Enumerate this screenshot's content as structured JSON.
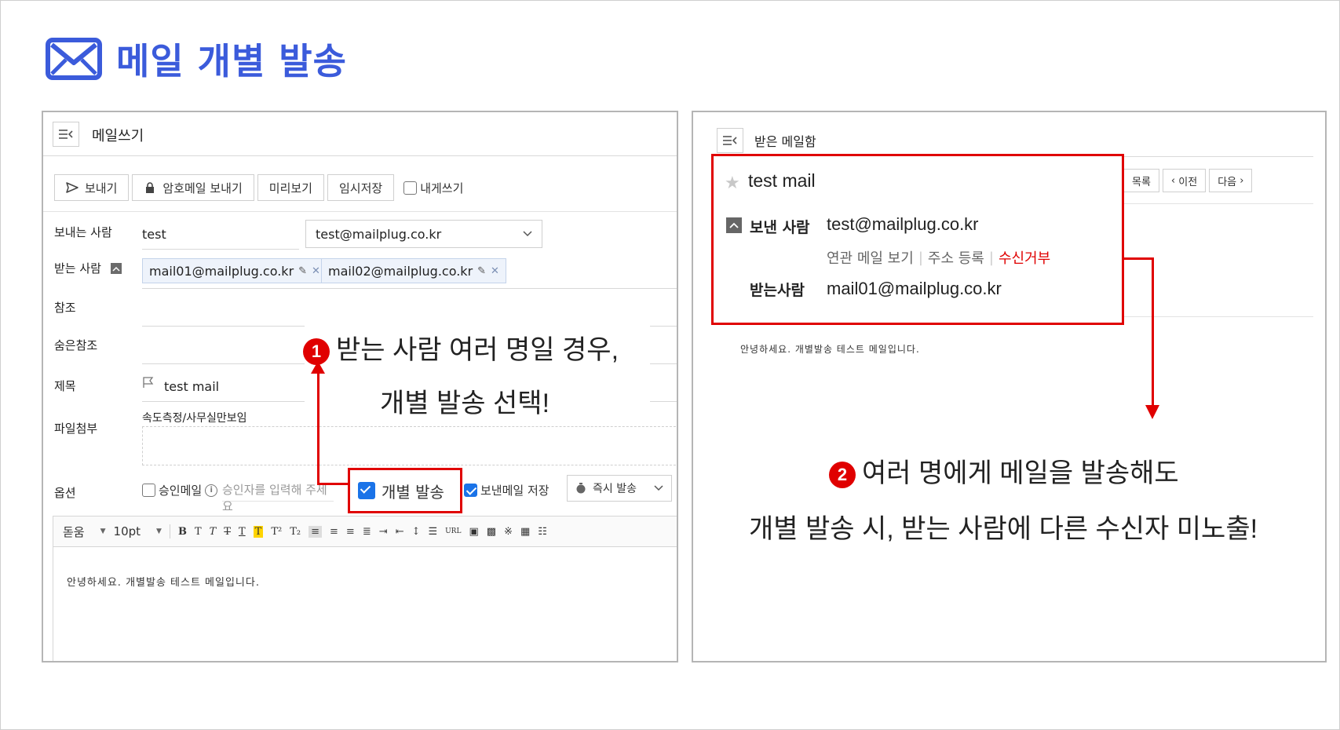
{
  "page": {
    "title": "메일 개별 발송",
    "accent_color": "#3b5bdb",
    "annotation_color": "#e00000"
  },
  "compose": {
    "header_title": "메일쓰기",
    "toolbar": {
      "send_label": "보내기",
      "secure_send_label": "암호메일 보내기",
      "preview_label": "미리보기",
      "draft_label": "임시저장",
      "self_label": "내게쓰기"
    },
    "from_label": "보내는 사람",
    "from_name": "test",
    "from_email": "test@mailplug.co.kr",
    "to_label": "받는 사람",
    "recipients": [
      "mail01@mailplug.co.kr",
      "mail02@mailplug.co.kr"
    ],
    "cc_label": "참조",
    "bcc_label": "숨은참조",
    "subject_label": "제목",
    "subject_value": "test mail",
    "attach_label": "파일첨부",
    "attach_file": "속도측정/사무실만보임",
    "options_label": "옵션",
    "approval_label": "승인메일",
    "approver_placeholder": "승인자를 입력해 주세요",
    "individual_send_label": "개별 발송",
    "save_sent_label": "보낸메일 저장",
    "send_timing": "즉시 발송",
    "editor_font": "돋움",
    "editor_size": "10pt",
    "body_text": "안녕하세요. 개별발송 테스트 메일입니다."
  },
  "callout1": {
    "number": "1",
    "line1": "받는 사람 여러 명일 경우,",
    "line2": "개별 발송 선택!"
  },
  "inbox": {
    "header_title": "받은 메일함",
    "nav_list": "목록",
    "nav_prev": "이전",
    "nav_next": "다음",
    "subject": "test mail",
    "from_label": "보낸 사람",
    "from_email": "test@mailplug.co.kr",
    "link_related": "연관 메일 보기",
    "link_address": "주소 등록",
    "link_block": "수신거부",
    "to_label": "받는사람",
    "to_email": "mail01@mailplug.co.kr",
    "body_text": "안녕하세요. 개별발송 테스트 메일입니다."
  },
  "callout2": {
    "number": "2",
    "line1": "여러 명에게 메일을 발송해도",
    "line2": "개별 발송 시, 받는 사람에 다른 수신자 미노출!"
  }
}
